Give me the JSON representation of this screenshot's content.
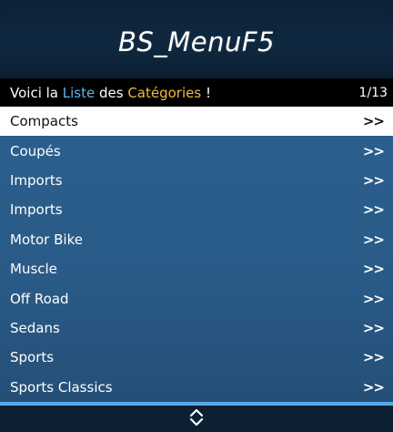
{
  "banner": {
    "title": "BS_MenuF5"
  },
  "subheader": {
    "prefix": "Voici la ",
    "word1": "Liste",
    "middle": " des ",
    "word2": "Catégories",
    "suffix": " !",
    "counter": "1/13"
  },
  "items": [
    {
      "label": "Compacts",
      "arrow": ">>"
    },
    {
      "label": "Coupés",
      "arrow": ">>"
    },
    {
      "label": "Imports",
      "arrow": ">>"
    },
    {
      "label": "Imports",
      "arrow": ">>"
    },
    {
      "label": "Motor Bike",
      "arrow": ">>"
    },
    {
      "label": "Muscle",
      "arrow": ">>"
    },
    {
      "label": "Off Road",
      "arrow": ">>"
    },
    {
      "label": "Sedans",
      "arrow": ">>"
    },
    {
      "label": "Sports",
      "arrow": ">>"
    },
    {
      "label": "Sports Classics",
      "arrow": ">>"
    }
  ],
  "footer": {
    "icon": "up-down-arrows-icon"
  },
  "colors": {
    "accent_blue": "#5db3ee",
    "accent_gold": "#eebd3c",
    "list_bg": "#2b5f8e",
    "selected_bg": "#ffffff"
  }
}
